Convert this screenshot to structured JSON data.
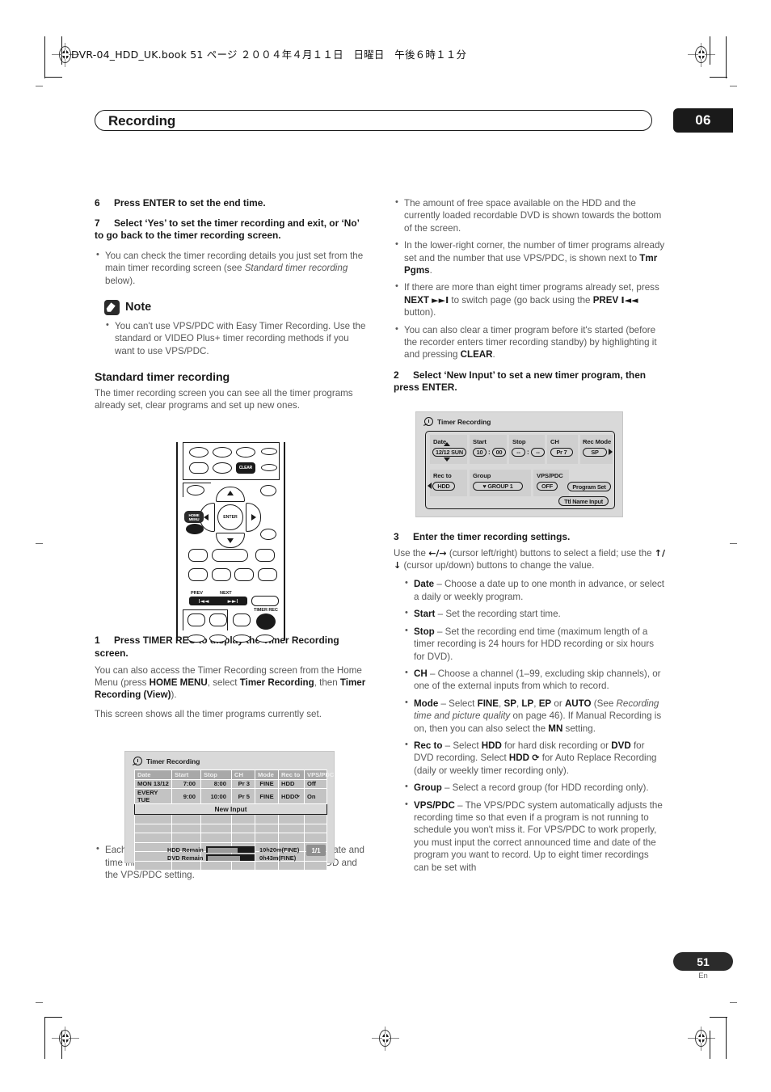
{
  "printer": {
    "file_line": "DVR-04_HDD_UK.book 51 ページ ２００４年４月１１日　日曜日　午後６時１１分"
  },
  "header": {
    "chapter_title": "Recording",
    "chapter_number": "06"
  },
  "footer": {
    "page_number": "51",
    "language": "En"
  },
  "left_column": {
    "step6": {
      "num": "6",
      "text": "Press ENTER to set the end time."
    },
    "step7": {
      "num": "7",
      "text": "Select ‘Yes’ to set the timer recording and exit, or ‘No’ to go back to the timer recording screen."
    },
    "step7_bullet": "You can check the timer recording details you just set from the main timer recording screen (see Standard timer recording below).",
    "note_label": "Note",
    "note_bullet": "You can't use VPS/PDC with Easy Timer Recording. Use the standard or VIDEO Plus+ timer recording methods if you want to use VPS/PDC.",
    "subhead": "Standard timer recording",
    "subhead_body": "The timer recording screen you can see all the timer programs already set, clear programs and set up new ones.",
    "step1": {
      "num": "1",
      "text": "Press TIMER REC to display the Timer Recording screen."
    },
    "step1_body_a": "You can also access the Timer Recording screen from the Home Menu (press HOME MENU, select Timer Recording, then Timer Recording (View)).",
    "step1_body_b": "This screen shows all the timer programs currently set.",
    "list_bullet": "Each row is for one timer recording program, with the date and time information, channel, recording mode, DVD or HDD and the VPS/PDC setting."
  },
  "right_column": {
    "bullets": [
      "The amount of free space available on the HDD and the currently loaded recordable DVD is shown towards the bottom of the screen.",
      "In the lower-right corner, the number of timer programs already set and the number that use VPS/PDC, is shown next to Tmr Pgms.",
      "If there are more than eight timer programs already set, press NEXT ►►I to switch page (go back using the PREV I◄◄ button).",
      "You can also clear a timer program before it's started (before the recorder enters timer recording standby) by highlighting it and pressing CLEAR."
    ],
    "step2": {
      "num": "2",
      "text": "Select ‘New Input’ to set a new timer program, then press ENTER."
    },
    "step3": {
      "num": "3",
      "text": "Enter the timer recording settings."
    },
    "step3_body": "Use the ←/→ (cursor left/right) buttons to select a field; use the ↑/↓ (cursor up/down) buttons to change the value.",
    "settings": [
      {
        "term": "Date",
        "desc": "– Choose a date up to one month in advance, or select a daily or weekly program."
      },
      {
        "term": "Start",
        "desc": "– Set the recording start time."
      },
      {
        "term": "Stop",
        "desc": "– Set the recording end time (maximum length of a timer recording is 24 hours for HDD recording or six hours for DVD)."
      },
      {
        "term": "CH",
        "desc": "– Choose a channel (1–99, excluding skip channels), or one of the external inputs from which to record."
      },
      {
        "term": "Mode",
        "desc": "– Select FINE, SP, LP, EP or AUTO (See Recording time and picture quality on page 46). If Manual Recording is on, then you can also select the MN setting."
      },
      {
        "term": "Rec to",
        "desc": "– Select HDD for hard disk recording or DVD for DVD recording. Select HDD ⟳ for Auto Replace Recording (daily or weekly timer recording only)."
      },
      {
        "term": "Group",
        "desc": "– Select a record group (for HDD recording only)."
      },
      {
        "term": "VPS/PDC",
        "desc": "– The VPS/PDC system automatically adjusts the recording time so that even if a program is not running to schedule you won't miss it. For VPS/PDC to work properly, you must input the correct announced time and date of the program you want to record. Up to eight timer recordings can be set with"
      }
    ]
  },
  "remote": {
    "clear_label": "CLEAR",
    "enter_label": "ENTER",
    "home_menu_label": "HOME MENU",
    "prev_label": "PREV",
    "next_label": "NEXT",
    "prev_glyph": "I◄◄",
    "next_glyph": "►►I",
    "timer_rec_label": "TIMER REC"
  },
  "osd_list": {
    "title": "Timer Recording",
    "columns": [
      "Date",
      "Start",
      "Stop",
      "CH",
      "Mode",
      "Rec to",
      "VPS/PDC"
    ],
    "rows": [
      [
        "MON 13/12",
        "7:00",
        "8:00",
        "Pr 3",
        "FINE",
        "HDD",
        "Off"
      ],
      [
        "EVERY TUE",
        "9:00",
        "10:00",
        "Pr 5",
        "FINE",
        "HDD⟳",
        "On"
      ]
    ],
    "new_input_label": "New Input",
    "hdd_remain_label": "HDD Remain",
    "hdd_remain_value": "10h20m(FINE)",
    "dvd_remain_label": "DVD Remain",
    "dvd_remain_value": "0h43m(FINE)",
    "page_indicator": "1/1"
  },
  "osd_setup": {
    "title": "Timer Recording",
    "fields_row1": [
      {
        "label": "Date",
        "value": "12/12 SUN"
      },
      {
        "label": "Start",
        "value_h": "10",
        "value_m": "00",
        "sep": ":"
      },
      {
        "label": "Stop",
        "value_h": "--",
        "value_m": "--",
        "sep": ":"
      },
      {
        "label": "CH",
        "value": "Pr 7"
      },
      {
        "label": "Rec Mode",
        "value": "SP"
      }
    ],
    "fields_row2": [
      {
        "label": "Rec to",
        "value": "HDD"
      },
      {
        "label": "Group",
        "value": "♥ GROUP 1"
      },
      {
        "label": "VPS/PDC",
        "value": "OFF"
      }
    ],
    "program_set_label": "Program Set",
    "title_name_input_label": "Ttl Name Input"
  }
}
